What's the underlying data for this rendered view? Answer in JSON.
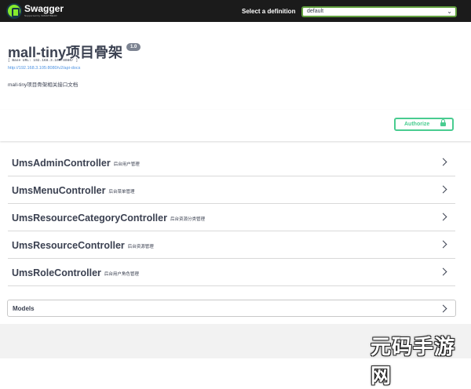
{
  "topbar": {
    "brand": "Swagger",
    "brand_sub": "Supported by SMARTBEAR",
    "definition_label": "Select a definition",
    "definition_value": "default"
  },
  "info": {
    "title": "mall-tiny项目骨架",
    "version": "1.0",
    "base_url": "[ Base URL: 192.168.3.105:8080/ ]",
    "doc_link": "http://192.168.3.105:8080/v2/api-docs",
    "description": "mall-tiny项目骨架相关接口文档"
  },
  "authorize_label": "Authorize",
  "controllers": [
    {
      "name": "UmsAdminController",
      "desc": "后台用户管理"
    },
    {
      "name": "UmsMenuController",
      "desc": "后台菜单管理"
    },
    {
      "name": "UmsResourceCategoryController",
      "desc": "后台资源分类管理"
    },
    {
      "name": "UmsResourceController",
      "desc": "后台资源管理"
    },
    {
      "name": "UmsRoleController",
      "desc": "后台用户角色管理"
    }
  ],
  "models_label": "Models",
  "watermark": "元码手游网",
  "colors": {
    "topbar": "#1b1b1b",
    "accent_green": "#62a03f",
    "authorize_green": "#49cc90",
    "link_blue": "#4990e2",
    "text": "#3b4151"
  }
}
